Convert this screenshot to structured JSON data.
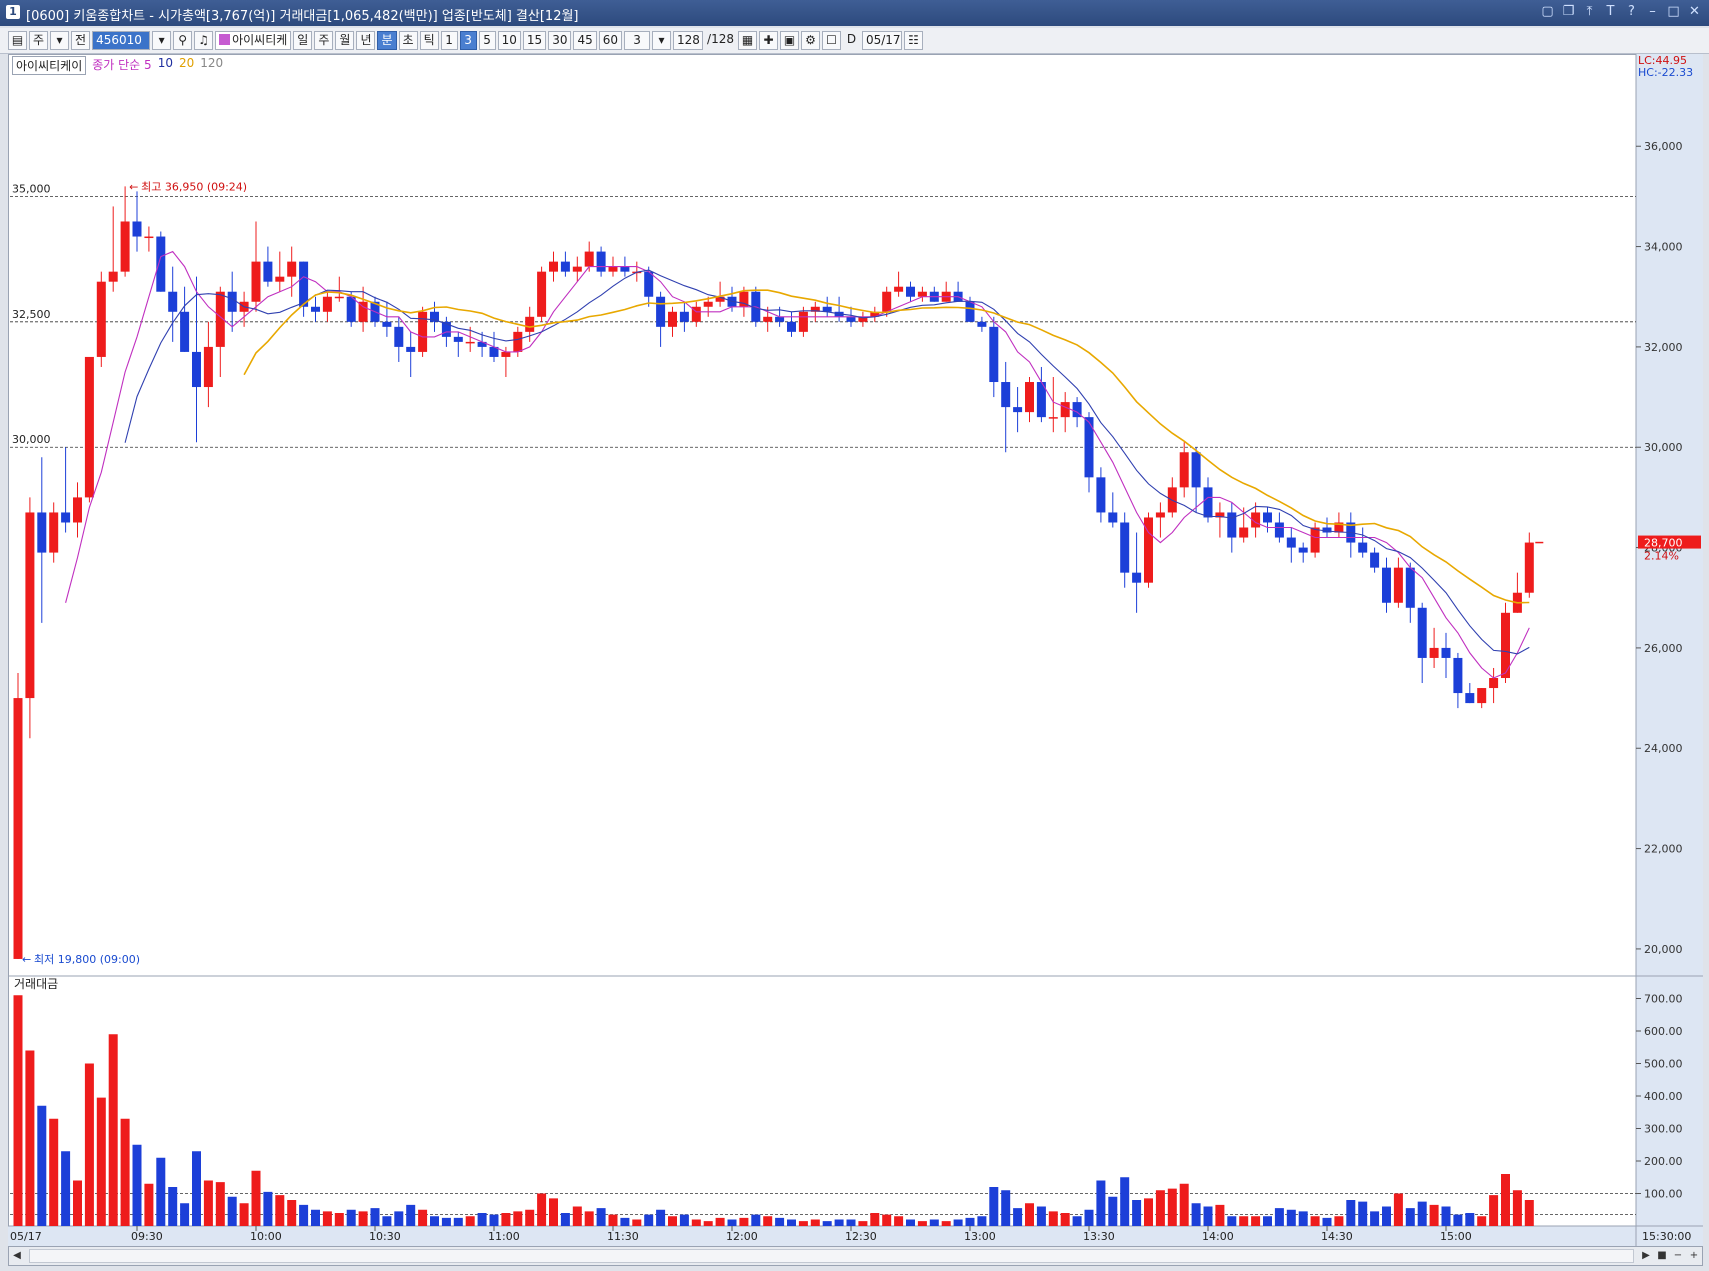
{
  "window": {
    "title": "[0600] 키움종합차트 - 시가총액[3,767(억)] 거래대금[1,065,482(백만)] 업종[반도체] 결산[12월]",
    "app_badge": "1",
    "buttons": [
      "▢",
      "❐",
      "⤒",
      "T",
      "?",
      "–",
      "□",
      "✕"
    ]
  },
  "toolbar": {
    "mode": "주",
    "prev": "전",
    "code": "456010",
    "search_icon": "magnifier-icon",
    "stock_name": "아이씨티케",
    "periods": [
      "일",
      "주",
      "월",
      "년",
      "분",
      "초",
      "틱"
    ],
    "selected_period": "분",
    "intervals": [
      "1",
      "3",
      "5",
      "10",
      "15",
      "30",
      "45",
      "60"
    ],
    "selected_interval": "3",
    "interval_value": "3",
    "count": "128",
    "count_total": "/128",
    "date_checkbox_label": "D",
    "date": "05/17"
  },
  "legend": {
    "stock": "아이씨티케이",
    "ma_label": "종가 단순 5",
    "ma10": "10",
    "ma20": "20",
    "ma120": "120"
  },
  "price_pane": {
    "lc": "LC:44.95",
    "hc": "HC:-22.33",
    "high_marker": "최고 36,950 (09:24)",
    "low_marker": "최저 19,800 (09:00)",
    "current_price": "28,700",
    "current_change": "2.14%",
    "left_levels": [
      "35,000",
      "32,500",
      "30,000"
    ]
  },
  "volume_pane": {
    "title": "거래대금"
  },
  "colors": {
    "up": "#ee1c1c",
    "down": "#1c3fd8",
    "ma5": "#c030c0",
    "ma10": "#3040b0",
    "ma20": "#e8a800",
    "ma120": "#666666",
    "axis_bg": "#dde6f3"
  },
  "chart_data": {
    "type": "candlestick",
    "interval_minutes": 3,
    "date": "05/17",
    "price_ylim": [
      19500,
      37400
    ],
    "price_yticks": [
      20000,
      22000,
      24000,
      26000,
      28000,
      30000,
      32000,
      34000,
      36000
    ],
    "price_ytick_labels": [
      "20,000",
      "22,000",
      "24,000",
      "26,000",
      "28,000",
      "30,000",
      "32,000",
      "34,000",
      "36,000"
    ],
    "reference_lines": [
      35000,
      32500,
      30000
    ],
    "volume_ylim": [
      0,
      760
    ],
    "volume_yticks": [
      100,
      200,
      300,
      400,
      500,
      600,
      700
    ],
    "volume_ytick_labels": [
      "100.00",
      "200.00",
      "300.00",
      "400.00",
      "500.00",
      "600.00",
      "700.00"
    ],
    "volume_reference_lines": [
      100,
      35
    ],
    "x_labels": [
      "05/17",
      "09:30",
      "10:00",
      "10:30",
      "11:00",
      "11:30",
      "12:00",
      "12:30",
      "13:00",
      "13:30",
      "14:00",
      "14:30",
      "15:00",
      "15:30:00"
    ],
    "x_label_bar_index": [
      0,
      10,
      20,
      30,
      40,
      50,
      60,
      70,
      80,
      90,
      100,
      110,
      120,
      137
    ],
    "candles": [
      [
        19800,
        25500,
        19800,
        25000,
        710
      ],
      [
        25000,
        29000,
        24200,
        28700,
        540
      ],
      [
        28700,
        29800,
        26500,
        27900,
        370
      ],
      [
        27900,
        28900,
        27700,
        28700,
        330
      ],
      [
        28700,
        30000,
        28300,
        28500,
        230
      ],
      [
        28500,
        29300,
        28200,
        29000,
        140
      ],
      [
        29000,
        31800,
        28900,
        31800,
        500
      ],
      [
        31800,
        33500,
        31600,
        33300,
        395
      ],
      [
        33300,
        34800,
        33100,
        33500,
        590
      ],
      [
        33500,
        35200,
        33400,
        34500,
        330
      ],
      [
        34500,
        35100,
        33900,
        34200,
        250
      ],
      [
        34200,
        34400,
        33900,
        34200,
        130
      ],
      [
        34200,
        34300,
        33100,
        33100,
        210
      ],
      [
        33100,
        33600,
        32100,
        32700,
        120
      ],
      [
        32700,
        33200,
        31900,
        31900,
        70
      ],
      [
        31900,
        33400,
        30100,
        31200,
        230
      ],
      [
        31200,
        32500,
        30800,
        32000,
        140
      ],
      [
        32000,
        33200,
        31400,
        33100,
        135
      ],
      [
        33100,
        33500,
        32300,
        32700,
        90
      ],
      [
        32700,
        33100,
        32400,
        32900,
        70
      ],
      [
        32900,
        34500,
        32700,
        33700,
        170
      ],
      [
        33700,
        34000,
        33200,
        33300,
        105
      ],
      [
        33300,
        33900,
        33100,
        33400,
        95
      ],
      [
        33400,
        34000,
        33000,
        33700,
        80
      ],
      [
        33700,
        33700,
        32600,
        32800,
        65
      ],
      [
        32800,
        33000,
        32500,
        32700,
        50
      ],
      [
        32700,
        33100,
        32500,
        33000,
        45
      ],
      [
        33000,
        33400,
        32900,
        33000,
        40
      ],
      [
        33000,
        33100,
        32400,
        32500,
        50
      ],
      [
        32500,
        33200,
        32300,
        32900,
        45
      ],
      [
        32900,
        33000,
        32400,
        32500,
        55
      ],
      [
        32500,
        32900,
        32200,
        32400,
        30
      ],
      [
        32400,
        32600,
        31700,
        32000,
        45
      ],
      [
        32000,
        32300,
        31400,
        31900,
        65
      ],
      [
        31900,
        32800,
        31800,
        32700,
        50
      ],
      [
        32700,
        32900,
        32300,
        32500,
        30
      ],
      [
        32500,
        32600,
        32000,
        32200,
        25
      ],
      [
        32200,
        32300,
        31800,
        32100,
        25
      ],
      [
        32100,
        32400,
        31900,
        32100,
        30
      ],
      [
        32100,
        32300,
        31800,
        32000,
        40
      ],
      [
        32000,
        32300,
        31700,
        31800,
        35
      ],
      [
        31800,
        32000,
        31400,
        31900,
        40
      ],
      [
        31900,
        32400,
        31800,
        32300,
        45
      ],
      [
        32300,
        32800,
        32100,
        32600,
        50
      ],
      [
        32600,
        33600,
        32500,
        33500,
        100
      ],
      [
        33500,
        33900,
        33300,
        33700,
        85
      ],
      [
        33700,
        33900,
        33400,
        33500,
        40
      ],
      [
        33500,
        33800,
        33300,
        33600,
        60
      ],
      [
        33600,
        34100,
        33500,
        33900,
        45
      ],
      [
        33900,
        34000,
        33400,
        33500,
        55
      ],
      [
        33500,
        33800,
        33400,
        33600,
        35
      ],
      [
        33600,
        33800,
        33400,
        33500,
        25
      ],
      [
        33500,
        33700,
        33300,
        33500,
        20
      ],
      [
        33500,
        33600,
        32800,
        33000,
        35
      ],
      [
        33000,
        33100,
        32000,
        32400,
        50
      ],
      [
        32400,
        32800,
        32200,
        32700,
        30
      ],
      [
        32700,
        32900,
        32300,
        32500,
        35
      ],
      [
        32500,
        32900,
        32400,
        32800,
        20
      ],
      [
        32800,
        33000,
        32600,
        32900,
        15
      ],
      [
        32900,
        33300,
        32800,
        33000,
        25
      ],
      [
        33000,
        33200,
        32700,
        32800,
        20
      ],
      [
        32800,
        33200,
        32600,
        33100,
        25
      ],
      [
        33100,
        33200,
        32400,
        32500,
        35
      ],
      [
        32500,
        32800,
        32300,
        32600,
        30
      ],
      [
        32600,
        32800,
        32400,
        32500,
        25
      ],
      [
        32500,
        32700,
        32200,
        32300,
        20
      ],
      [
        32300,
        32800,
        32200,
        32700,
        15
      ],
      [
        32700,
        32900,
        32500,
        32800,
        20
      ],
      [
        32800,
        33000,
        32600,
        32700,
        15
      ],
      [
        32700,
        33000,
        32500,
        32600,
        20
      ],
      [
        32600,
        32800,
        32400,
        32500,
        20
      ],
      [
        32500,
        32700,
        32400,
        32600,
        15
      ],
      [
        32600,
        32800,
        32500,
        32700,
        40
      ],
      [
        32700,
        33200,
        32600,
        33100,
        35
      ],
      [
        33100,
        33500,
        33000,
        33200,
        30
      ],
      [
        33200,
        33300,
        32900,
        33000,
        20
      ],
      [
        33000,
        33200,
        32900,
        33100,
        15
      ],
      [
        33100,
        33200,
        32900,
        32900,
        20
      ],
      [
        32900,
        33300,
        32900,
        33100,
        15
      ],
      [
        33100,
        33300,
        32900,
        32900,
        20
      ],
      [
        32900,
        33000,
        32500,
        32500,
        25
      ],
      [
        32500,
        32600,
        32300,
        32400,
        30
      ],
      [
        32400,
        32600,
        31000,
        31300,
        120
      ],
      [
        31300,
        31700,
        29900,
        30800,
        110
      ],
      [
        30800,
        31200,
        30300,
        30700,
        55
      ],
      [
        30700,
        31400,
        30500,
        31300,
        70
      ],
      [
        31300,
        31600,
        30500,
        30600,
        60
      ],
      [
        30600,
        31400,
        30300,
        30600,
        45
      ],
      [
        30600,
        31100,
        30300,
        30900,
        40
      ],
      [
        30900,
        31000,
        30400,
        30600,
        30
      ],
      [
        30600,
        30700,
        29100,
        29400,
        50
      ],
      [
        29400,
        29600,
        28500,
        28700,
        140
      ],
      [
        28700,
        29100,
        28400,
        28500,
        90
      ],
      [
        28500,
        28700,
        27200,
        27500,
        150
      ],
      [
        27500,
        28300,
        26700,
        27300,
        80
      ],
      [
        27300,
        28700,
        27200,
        28600,
        85
      ],
      [
        28600,
        28900,
        28200,
        28700,
        110
      ],
      [
        28700,
        29400,
        28600,
        29200,
        115
      ],
      [
        29200,
        30100,
        29000,
        29900,
        130
      ],
      [
        29900,
        30000,
        28700,
        29200,
        70
      ],
      [
        29200,
        29400,
        28500,
        28600,
        60
      ],
      [
        28600,
        28900,
        28200,
        28700,
        65
      ],
      [
        28700,
        28900,
        27900,
        28200,
        30
      ],
      [
        28200,
        28800,
        28100,
        28400,
        30
      ],
      [
        28400,
        28900,
        28200,
        28700,
        30
      ],
      [
        28700,
        28800,
        28300,
        28500,
        30
      ],
      [
        28500,
        28700,
        28100,
        28200,
        55
      ],
      [
        28200,
        28400,
        27700,
        28000,
        50
      ],
      [
        28000,
        28100,
        27700,
        27900,
        45
      ],
      [
        27900,
        28500,
        27800,
        28400,
        30
      ],
      [
        28400,
        28600,
        28200,
        28300,
        25
      ],
      [
        28300,
        28700,
        28200,
        28500,
        30
      ],
      [
        28500,
        28700,
        27800,
        28100,
        80
      ],
      [
        28100,
        28400,
        27800,
        27900,
        75
      ],
      [
        27900,
        28000,
        27500,
        27600,
        45
      ],
      [
        27600,
        27800,
        26700,
        26900,
        60
      ],
      [
        26900,
        27800,
        26800,
        27600,
        100
      ],
      [
        27600,
        27700,
        26500,
        26800,
        55
      ],
      [
        26800,
        26900,
        25300,
        25800,
        75
      ],
      [
        25800,
        26400,
        25600,
        26000,
        65
      ],
      [
        26000,
        26300,
        25400,
        25800,
        60
      ],
      [
        25800,
        25900,
        24800,
        25100,
        35
      ],
      [
        25100,
        25300,
        24900,
        24900,
        40
      ],
      [
        24900,
        25200,
        24800,
        25200,
        30
      ],
      [
        25200,
        25600,
        24900,
        25400,
        95
      ],
      [
        25400,
        26900,
        25300,
        26700,
        160
      ],
      [
        26700,
        27500,
        26700,
        27100,
        110
      ],
      [
        27100,
        28300,
        27000,
        28100,
        80
      ]
    ],
    "ma5": [
      null,
      null,
      null,
      null,
      26900,
      27800,
      28800,
      29500,
      30500,
      31500,
      32200,
      33000,
      33800,
      33900,
      33600,
      33100,
      32800,
      32600,
      32400,
      32600,
      32800,
      33000,
      33100,
      33200,
      33400,
      33300,
      33100,
      33100,
      33000,
      32800,
      32700,
      32600,
      32600,
      32300,
      32200,
      32200,
      32300,
      32300,
      32200,
      32100,
      32000,
      31900,
      31900,
      32000,
      32300,
      32700,
      33000,
      33300,
      33600,
      33600,
      33600,
      33600,
      33600,
      33500,
      33300,
      33000,
      32900,
      32700,
      32700,
      32700,
      32800,
      32800,
      32800,
      32700,
      32600,
      32600,
      32600,
      32600,
      32600,
      32600,
      32600,
      32600,
      32600,
      32700,
      32800,
      32900,
      33000,
      33000,
      33000,
      33000,
      32900,
      32800,
      32500,
      32300,
      31900,
      31700,
      31300,
      30900,
      30800,
      30700,
      30500,
      30100,
      29700,
      29200,
      28700,
      28300,
      28100,
      28300,
      28600,
      28800,
      29000,
      29000,
      28900,
      28700,
      28500,
      28400,
      28400,
      28400,
      28300,
      28200,
      28200,
      28200,
      28200,
      28200,
      28200,
      28100,
      27900,
      27600,
      27400,
      27000,
      26600,
      26300,
      25900,
      25600,
      25400,
      25500,
      25900,
      26400
    ]
  }
}
